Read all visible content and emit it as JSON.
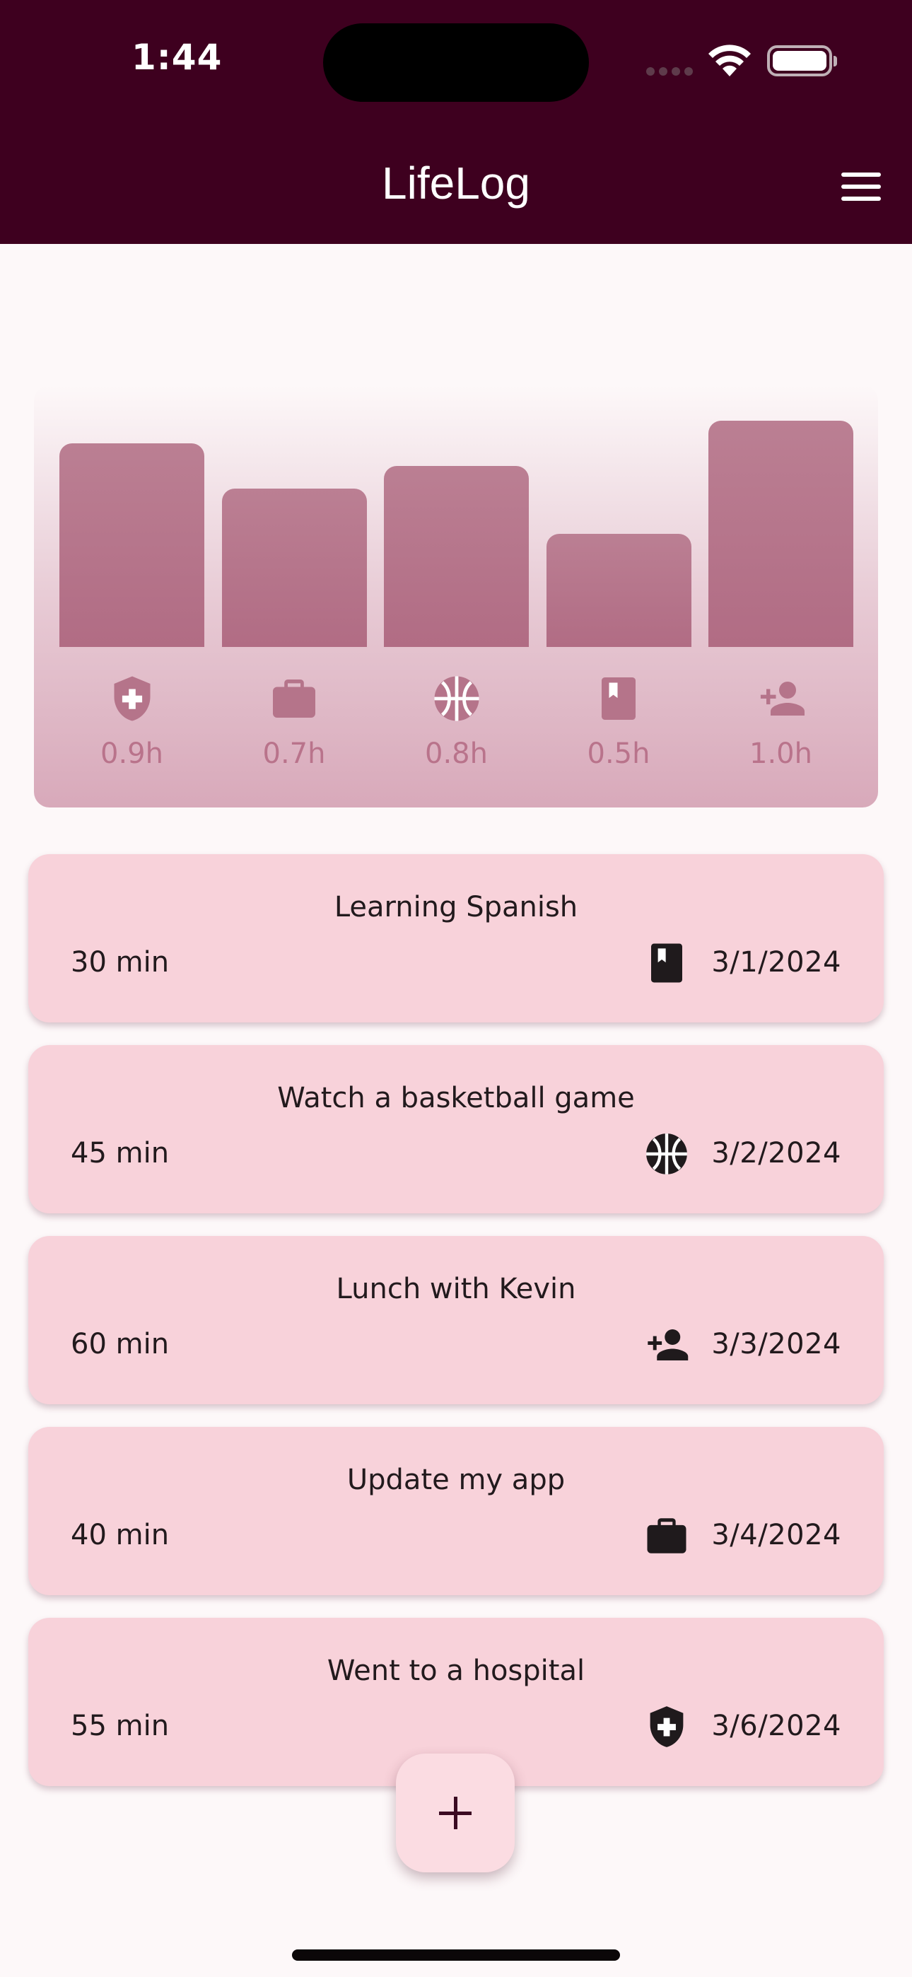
{
  "status_bar": {
    "time": "1:44"
  },
  "app": {
    "title": "LifeLog"
  },
  "chart_data": {
    "type": "bar",
    "categories": [
      "health",
      "work",
      "sports",
      "study",
      "social"
    ],
    "values": [
      0.9,
      0.7,
      0.8,
      0.5,
      1.0
    ],
    "labels": [
      "0.9h",
      "0.7h",
      "0.8h",
      "0.5h",
      "1.0h"
    ],
    "icons": [
      "health-shield-icon",
      "work-briefcase-icon",
      "basketball-icon",
      "book-icon",
      "person-add-icon"
    ],
    "bar_color": "#b5748a",
    "ylim": [
      0,
      1.0
    ],
    "grid": false
  },
  "entries": [
    {
      "title": "Learning Spanish",
      "duration": "30 min",
      "date": "3/1/2024",
      "icon": "book-icon"
    },
    {
      "title": "Watch a basketball game",
      "duration": "45 min",
      "date": "3/2/2024",
      "icon": "basketball-icon"
    },
    {
      "title": "Lunch with Kevin",
      "duration": "60 min",
      "date": "3/3/2024",
      "icon": "person-add-icon"
    },
    {
      "title": "Update my app",
      "duration": "40 min",
      "date": "3/4/2024",
      "icon": "work-briefcase-icon"
    },
    {
      "title": "Went to a hospital",
      "duration": "55 min",
      "date": "3/6/2024",
      "icon": "health-shield-icon"
    }
  ],
  "fab": {
    "icon": "plus-icon"
  },
  "colors": {
    "app_bar": "#3e001f",
    "card": "#f8d2da",
    "bar": "#b5748a",
    "bar_label": "#b9738b"
  }
}
